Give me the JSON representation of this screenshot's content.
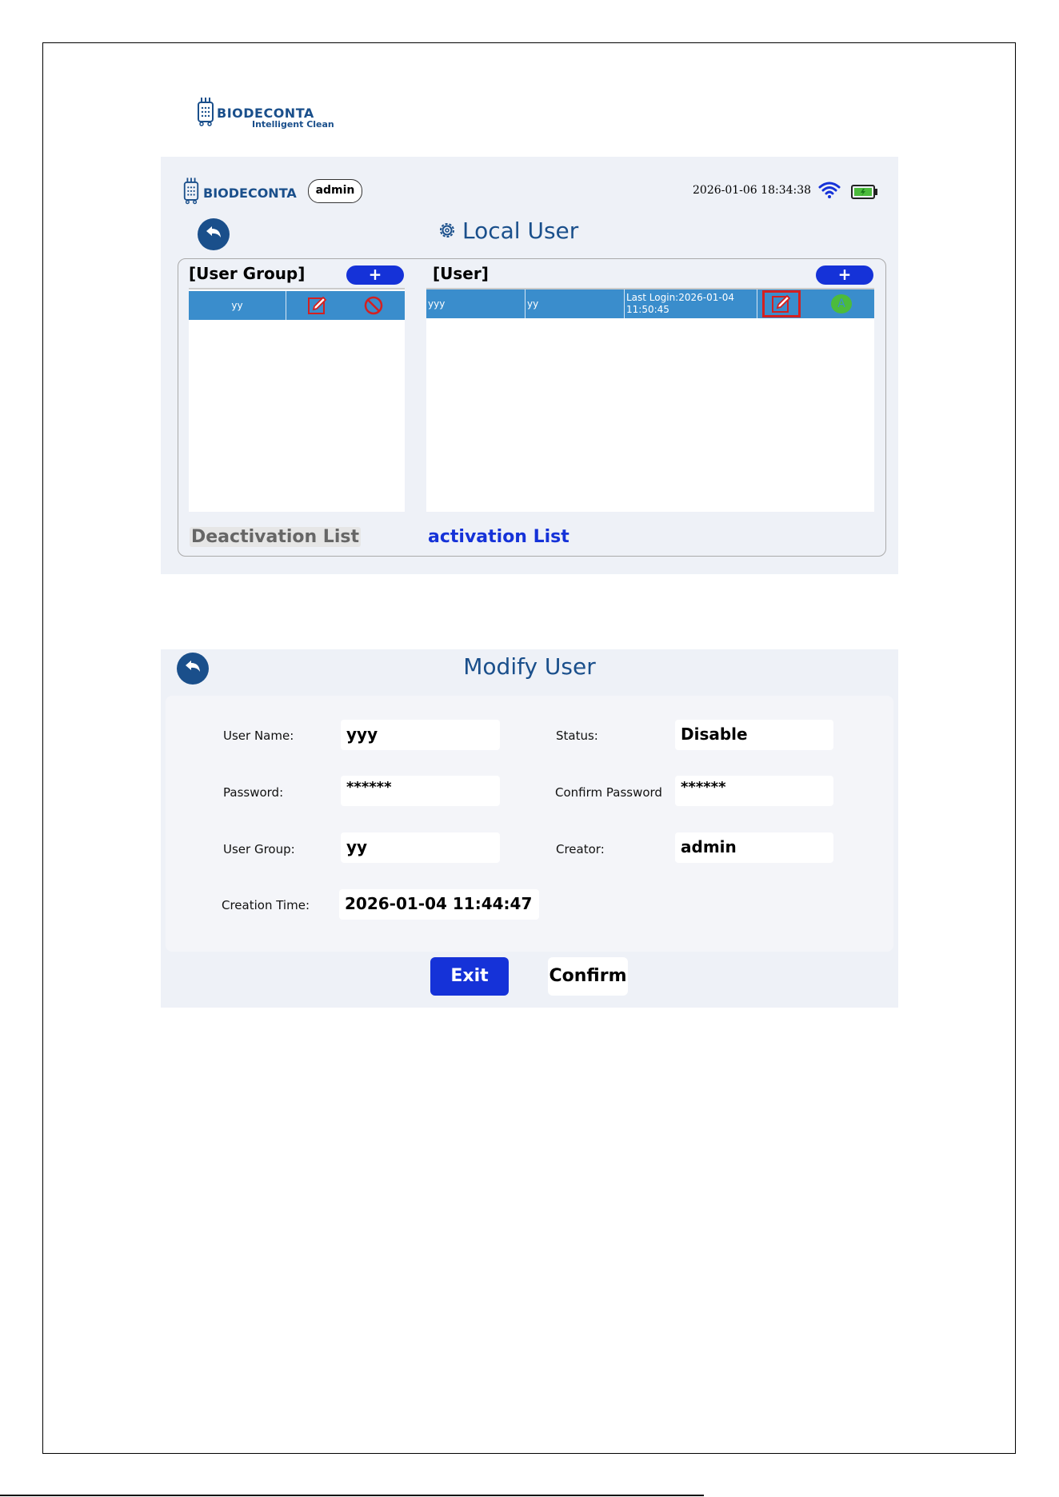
{
  "document": {
    "brand": "BIODECONTA",
    "tagline": "Intelligent Clean"
  },
  "local_user_screen": {
    "brand": "BIODECONTA",
    "current_user": "admin",
    "datetime": "2026-01-06 18:34:38",
    "title": "Local User",
    "user_group_header": "[User Group]",
    "user_header": "[User]",
    "add_label": "+",
    "groups": [
      {
        "name": "yy"
      }
    ],
    "users": [
      {
        "name": "yyy",
        "group": "yy",
        "last_login_line1": "Last Login:2026-01-04",
        "last_login_line2": "11:50:45",
        "status_letter": "A"
      }
    ],
    "deactivation_list": "Deactivation List",
    "activation_list": "activation List",
    "colors": {
      "accent": "#1532d8",
      "row": "#3a8dcc",
      "title": "#1a4f8b",
      "edit": "#d42020"
    }
  },
  "modify_user_screen": {
    "title": "Modify User",
    "fields": {
      "user_name_label": "User Name:",
      "user_name": "yyy",
      "status_label": "Status:",
      "status": "Disable",
      "password_label": "Password:",
      "password": "******",
      "confirm_password_label": "Confirm Password",
      "confirm_password": "******",
      "user_group_label": "User Group:",
      "user_group": "yy",
      "creator_label": "Creator:",
      "creator": "admin",
      "creation_time_label": "Creation Time:",
      "creation_time": "2026-01-04 11:44:47"
    },
    "exit_label": "Exit",
    "confirm_label": "Confirm"
  }
}
